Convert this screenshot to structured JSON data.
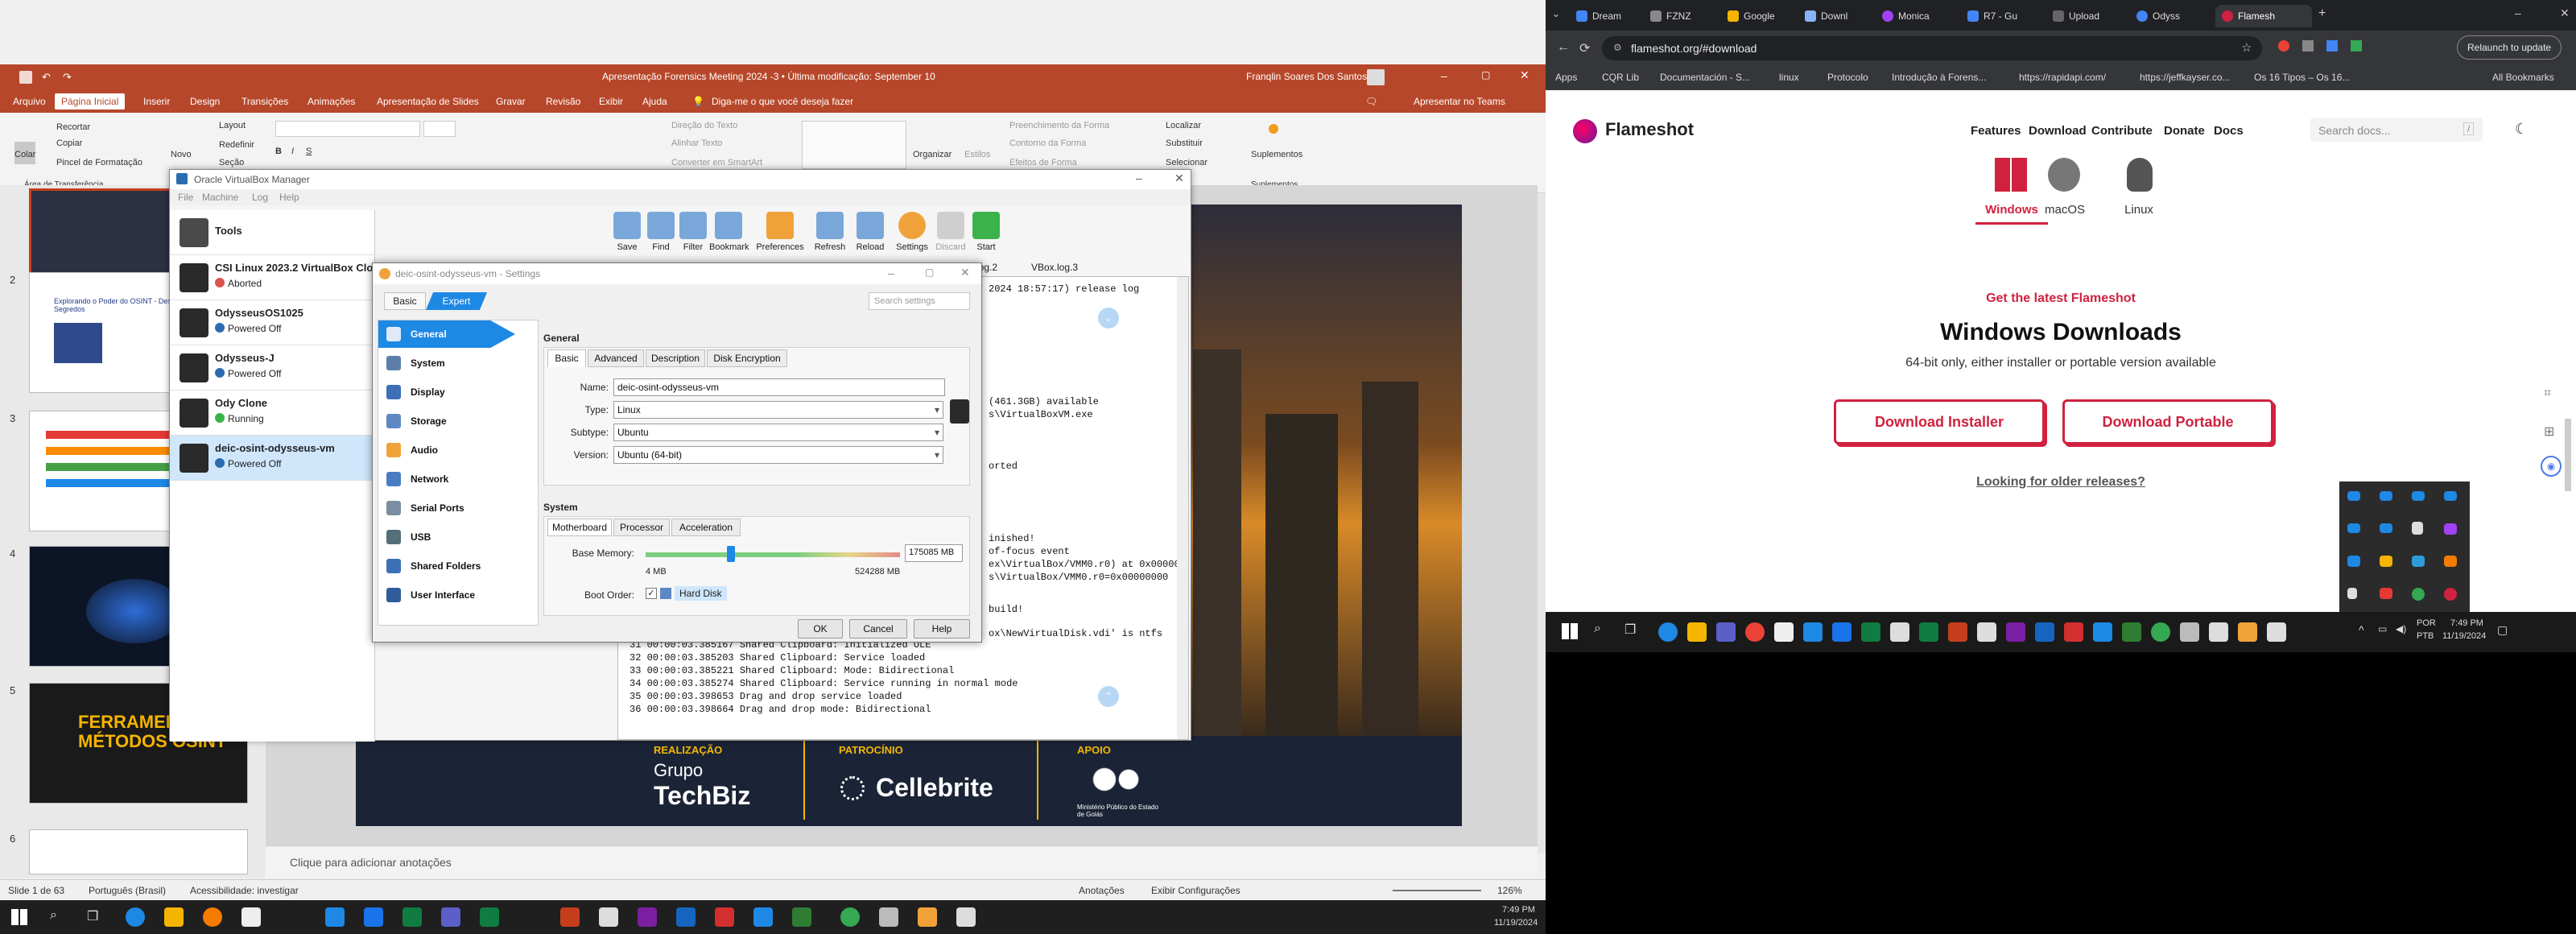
{
  "powerpoint": {
    "title": "Apresentação Forensics Meeting 2024 -3 • Última modificação: September 10",
    "user": "Franqlin Soares Dos Santos",
    "tabs": [
      "Arquivo",
      "Página Inicial",
      "Inserir",
      "Design",
      "Transições",
      "Animações",
      "Apresentação de Slides",
      "Gravar",
      "Revisão",
      "Exibir",
      "Ajuda"
    ],
    "search_placeholder": "Diga-me o que você deseja fazer",
    "present_teams": "Apresentar no Teams",
    "ribbon": {
      "clipboard": [
        "Recortar",
        "Copiar",
        "Pincel de Formatação"
      ],
      "paste": "Colar",
      "new_slide": "Novo",
      "layout": "Layout",
      "reset": "Redefinir",
      "section": "Seção",
      "clipboard_group": "Área de Transferência",
      "text_dir": "Direção do Texto",
      "align_text": "Alinhar Texto",
      "convert_smartart": "Converter em SmartArt",
      "organize": "Organizar",
      "styles": "Estilos",
      "fill": "Preenchimento da Forma",
      "outline": "Contorno da Forma",
      "effects": "Efeitos de Forma",
      "find": "Localizar",
      "replace": "Substituir",
      "select": "Selecionar",
      "addins": "Suplementos",
      "addins_group": "Suplementos"
    },
    "slide_numbers": [
      "2",
      "3",
      "4",
      "5",
      "6"
    ],
    "thumb_text": {
      "s5_title": "FERRAMENTAS E MÉTODOS OSINT",
      "s2_title": "Explorando o Poder do OSINT - Desvendando os Segredos"
    },
    "slide_footer": {
      "realizacao": "REALIZAÇÃO",
      "grupo": "Grupo",
      "techbiz": "TechBiz",
      "patrocinio": "PATROCÍNIO",
      "cellebrite": "Cellebrite",
      "apoio": "APOIO",
      "mp": "Ministério Público do Estado de Goiás"
    },
    "notes_placeholder": "Clique para adicionar anotações",
    "status": {
      "slide": "Slide 1 de 63",
      "lang": "Português (Brasil)",
      "accessibility": "Acessibilidade: investigar",
      "notes": "Anotações",
      "display": "Exibir Configurações",
      "zoom": "126%"
    }
  },
  "vbox": {
    "title": "Oracle VirtualBox Manager",
    "menu": [
      "File",
      "Machine",
      "Log",
      "Help"
    ],
    "tools_label": "Tools",
    "vms": [
      {
        "name": "CSI Linux 2023.2 VirtualBox Clone",
        "state": "Aborted",
        "color": "#d9534f"
      },
      {
        "name": "OdysseusOS1025",
        "state": "Powered Off",
        "color": "#2b6cb0"
      },
      {
        "name": "Odysseus-J",
        "state": "Powered Off",
        "color": "#2b6cb0"
      },
      {
        "name": "Ody Clone",
        "state": "Running",
        "color": "#3bb34a"
      },
      {
        "name": "deic-osint-odysseus-vm",
        "state": "Powered Off",
        "color": "#2b6cb0"
      }
    ],
    "toolbar": [
      "Save",
      "Find",
      "Filter",
      "Bookmark",
      "Preferences",
      "Refresh",
      "Reload",
      "Settings",
      "Discard",
      "Start"
    ],
    "log_tabs": [
      "log.2",
      "VBox.log.3"
    ],
    "log_lines": [
      "2024 18:57:17) release log",
      "(461.3GB) available",
      "s\\VirtualBoxVM.exe",
      "orted",
      "inished!",
      "of-focus event",
      "ex\\VirtualBox/VMM0.r0) at 0x00000000",
      "s\\VirtualBox/VMM0.r0=0x00000000",
      "build!",
      "ox\\NewVirtualDisk.vdi' is ntfs",
      "31 00:00:03.385167 Shared Clipboard: Initialized OLE",
      "32 00:00:03.385203 Shared Clipboard: Service loaded",
      "33 00:00:03.385221 Shared Clipboard: Mode: Bidirectional",
      "34 00:00:03.385274 Shared Clipboard: Service running in normal mode",
      "35 00:00:03.398653 Drag and drop service loaded",
      "36 00:00:03.398664 Drag and drop mode: Bidirectional"
    ]
  },
  "settings": {
    "title": "deic-osint-odysseus-vm - Settings",
    "mode_basic": "Basic",
    "mode_expert": "Expert",
    "search_placeholder": "Search settings",
    "sections": [
      "General",
      "System",
      "Display",
      "Storage",
      "Audio",
      "Network",
      "Serial Ports",
      "USB",
      "Shared Folders",
      "User Interface"
    ],
    "general_header": "General",
    "general_tabs": [
      "Basic",
      "Advanced",
      "Description",
      "Disk Encryption"
    ],
    "name_label": "Name:",
    "name_value": "deic-osint-odysseus-vm",
    "type_label": "Type:",
    "type_value": "Linux",
    "subtype_label": "Subtype:",
    "subtype_value": "Ubuntu",
    "version_label": "Version:",
    "version_value": "Ubuntu (64-bit)",
    "system_header": "System",
    "system_tabs": [
      "Motherboard",
      "Processor",
      "Acceleration"
    ],
    "memory_label": "Base Memory:",
    "memory_value": "175085 MB",
    "memory_min": "4 MB",
    "memory_max": "524288 MB",
    "memory_fraction": 0.334,
    "boot_label": "Boot Order:",
    "boot_item": "Hard Disk",
    "ok": "OK",
    "cancel": "Cancel",
    "help": "Help"
  },
  "browser": {
    "tabs": [
      "Dream",
      "FZNZ",
      "Google",
      "Downl",
      "Monica",
      "R7 - Gu",
      "Upload",
      "Odyss",
      "Flamesh"
    ],
    "url": "flameshot.org/#download",
    "relaunch": "Relaunch to update",
    "bookmarks": [
      "Apps",
      "CQR Lib",
      "Documentación - S...",
      "linux",
      "Protocolo",
      "Introdução à Forens...",
      "https://rapidapi.com/",
      "https://jeffkayser.co...",
      "Os 16 Tipos – Os 16...",
      "All Bookmarks"
    ],
    "site": {
      "brand": "Flameshot",
      "nav": [
        "Features",
        "Download",
        "Contribute",
        "Donate",
        "Docs"
      ],
      "search_placeholder": "Search docs...",
      "search_key": "/",
      "os": [
        "Windows",
        "macOS",
        "Linux"
      ],
      "kicker": "Get the latest Flameshot",
      "heading": "Windows Downloads",
      "sub": "64-bit only, either installer or portable version available",
      "btn_installer": "Download Installer",
      "btn_portable": "Download Portable",
      "older": "Looking for older releases?"
    }
  },
  "taskbar_right": {
    "lang1": "POR",
    "lang2": "PTB",
    "time": "7:49 PM",
    "date": "11/19/2024"
  },
  "taskbar_left": {
    "time": "7:49 PM",
    "date": "11/19/2024"
  },
  "colors": {
    "ppt_red": "#b7472a",
    "flameshot_red": "#d0213f",
    "vbox_select": "#cfe6fb",
    "settings_accent": "#1e88e5"
  }
}
